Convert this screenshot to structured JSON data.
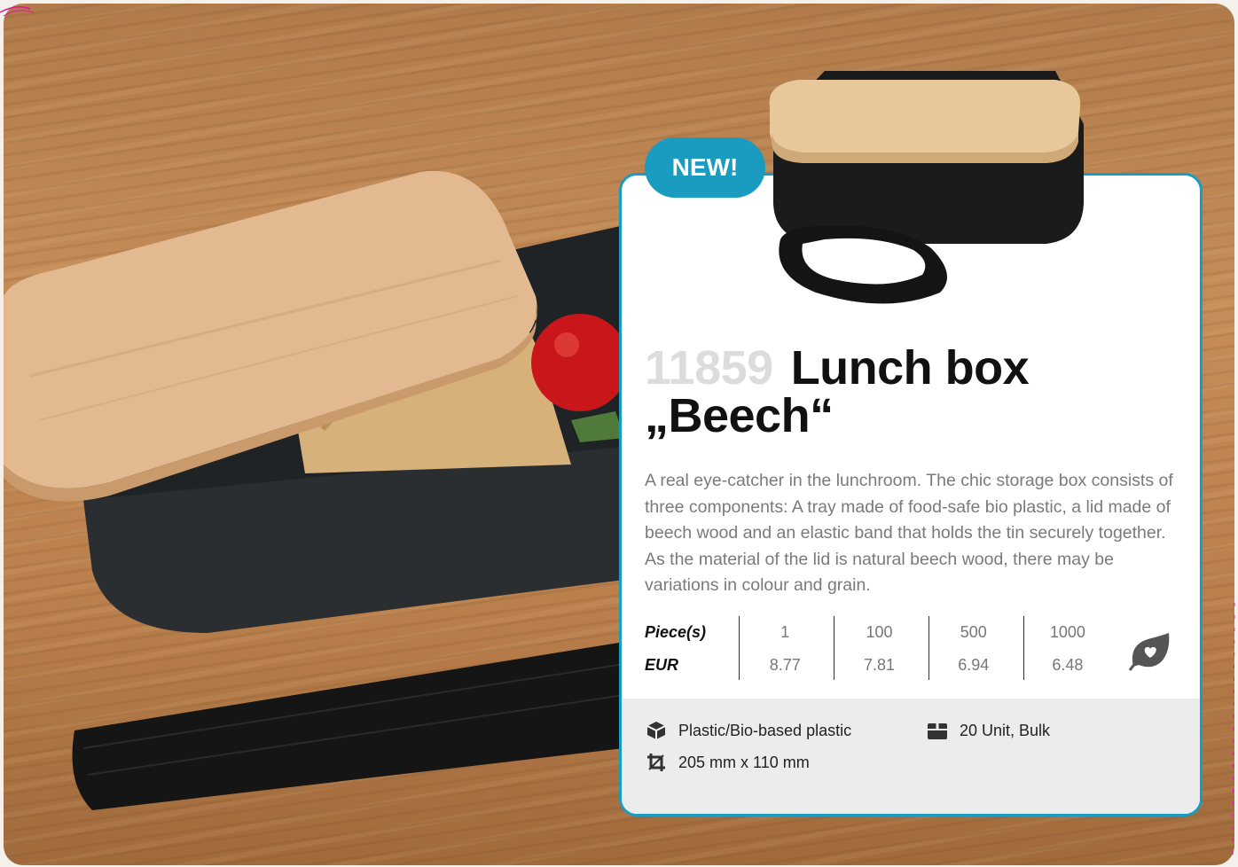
{
  "badge": {
    "label": "NEW!"
  },
  "product": {
    "article_number": "11859",
    "name_line1": "Lunch box",
    "name_line2": "„Beech“",
    "description": "A real eye-catcher in the lunchroom. The chic storage box consists of three components: A tray made of food-safe bio plastic, a lid made of beech wood and an elastic band that holds the tin securely together. As the material of the lid is natural beech wood, there may be variations in colour and grain."
  },
  "pricing": {
    "quantity_label": "Piece(s)",
    "currency_label": "EUR",
    "quantities": [
      "1",
      "100",
      "500",
      "1000"
    ],
    "prices": [
      "8.77",
      "7.81",
      "6.94",
      "6.48"
    ]
  },
  "specs": {
    "material": "Plastic/Bio-based plastic",
    "dimensions": "205 mm x 110 mm",
    "packaging": "20 Unit, Bulk"
  },
  "colors": {
    "accent": "#1a9bc0",
    "footer_bg": "#ececec",
    "article_number": "#dcdcdc",
    "description": "#7a7a7a"
  },
  "icons": [
    "package-icon",
    "crop-icon",
    "box-icon",
    "eco-leaf-heart-icon"
  ]
}
